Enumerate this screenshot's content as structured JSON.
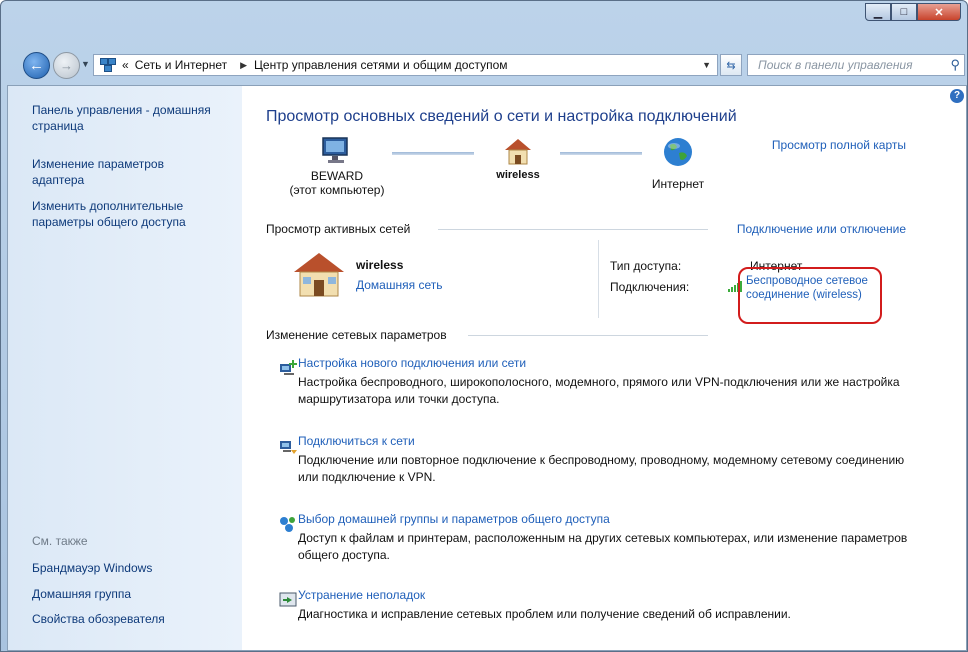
{
  "nav": {
    "breadcrumb": [
      "Сеть и Интернет",
      "Центр управления сетями и общим доступом"
    ],
    "overflow": "«",
    "search_placeholder": "Поиск в панели управления"
  },
  "sidebar": {
    "items": [
      "Панель управления - домашняя страница",
      "Изменение параметров адаптера",
      "Изменить дополнительные параметры общего доступа"
    ],
    "see_also_title": "См. также",
    "see_also": [
      "Брандмауэр Windows",
      "Домашняя группа",
      "Свойства обозревателя"
    ]
  },
  "main": {
    "title": "Просмотр основных сведений о сети и настройка подключений",
    "full_map_link": "Просмотр полной карты",
    "map": {
      "computer_name": "BEWARD",
      "computer_sub": "(этот компьютер)",
      "network": "wireless",
      "internet": "Интернет"
    },
    "active_title": "Просмотр активных сетей",
    "connect_link": "Подключение или отключение",
    "active": {
      "name": "wireless",
      "type_link": "Домашняя сеть",
      "access_label": "Тип доступа:",
      "access_value": "Интернет",
      "conn_label": "Подключения:",
      "conn_value": "Беспроводное сетевое соединение (wireless)"
    },
    "change_title": "Изменение сетевых параметров",
    "tasks": [
      {
        "title": "Настройка нового подключения или сети",
        "desc": "Настройка беспроводного, широкополосного, модемного, прямого или VPN-подключения или же настройка маршрутизатора или точки доступа."
      },
      {
        "title": "Подключиться к сети",
        "desc": "Подключение или повторное подключение к беспроводному, проводному, модемному сетевому соединению или подключение к VPN."
      },
      {
        "title": "Выбор домашней группы и параметров общего доступа",
        "desc": "Доступ к файлам и принтерам, расположенным на других сетевых компьютерах, или изменение параметров общего доступа."
      },
      {
        "title": "Устранение неполадок",
        "desc": "Диагностика и исправление сетевых проблем или получение сведений об исправлении."
      }
    ]
  }
}
